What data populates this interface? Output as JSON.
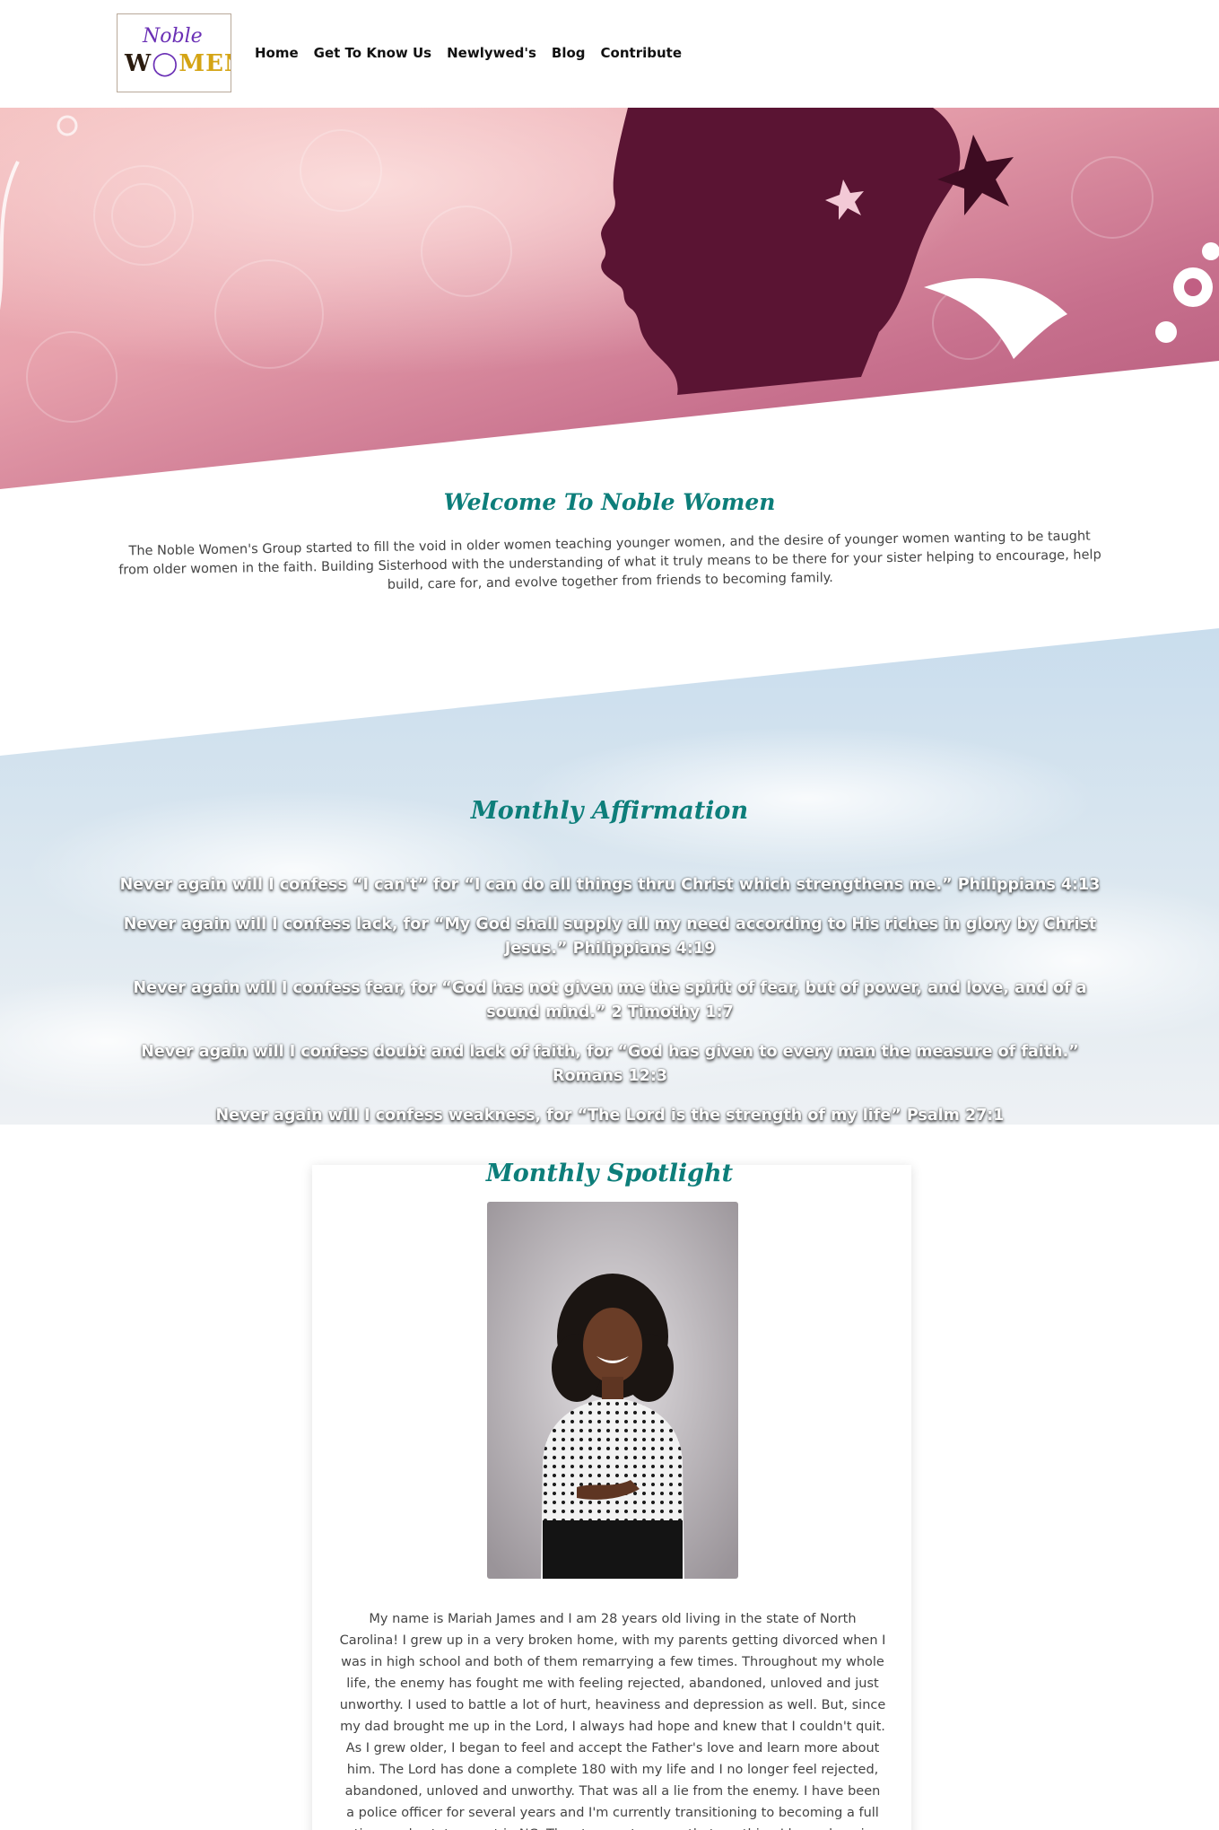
{
  "header": {
    "logo_top": "Noble",
    "logo_bottom_a": "W",
    "logo_bottom_b": "MEN",
    "nav": [
      "Home",
      "Get To Know Us",
      "Newlywed's",
      "Blog",
      "Contribute"
    ]
  },
  "welcome": {
    "title": "Welcome To Noble Women",
    "text": "The Noble Women's Group started to fill the void in older women teaching younger women, and the desire of younger women wanting to be taught from older women in the faith. Building Sisterhood with the understanding of what it truly means to be there for your sister helping to encourage, help build, care for, and evolve together from friends to becoming family."
  },
  "affirmation": {
    "title": "Monthly Affirmation",
    "lines": [
      "Never again will I confess “I can't” for “I can do all things thru Christ which strengthens me.” Philippians 4:13",
      "Never again will I confess lack, for “My God shall supply all my need according to His riches in glory by Christ Jesus.” Philippians 4:19",
      "Never again will I confess fear, for “God has not given me the spirit of fear, but of power, and love, and of a sound mind.” 2 Timothy 1:7",
      "Never again will I confess doubt and lack of faith, for “God has given to every man the measure of faith.” Romans 12:3",
      "Never again will I confess weakness, for “The Lord is the strength of my life” Psalm 27:1"
    ]
  },
  "spotlight": {
    "title": "Monthly Spotlight",
    "text": "My name is Mariah James and I am 28 years old living in the state of North Carolina! I grew up in a very broken home, with my parents getting divorced when I was in high school and both of them remarrying a few times. Throughout my whole life, the enemy has fought me with feeling rejected, abandoned, unloved and just unworthy. I used to battle a lot of hurt, heaviness and depression as well. But, since my dad brought me up in the Lord, I always had hope and knew that I couldn't quit. As I grew older, I began to feel and accept the Father's love and learn more about him. The Lord has done a complete 180 with my life and I no longer feel rejected, abandoned, unloved and unworthy. That was all a lie from the enemy. I have been a police officer for several years and I'm currently transitioning to becoming a full time real estate agent in NC. The strongest reason that anything I have done is good is that"
  },
  "colors": {
    "accent": "#0d7e7a",
    "hero_dark": "#5a1433",
    "hero_pink": "#d98aa0"
  }
}
